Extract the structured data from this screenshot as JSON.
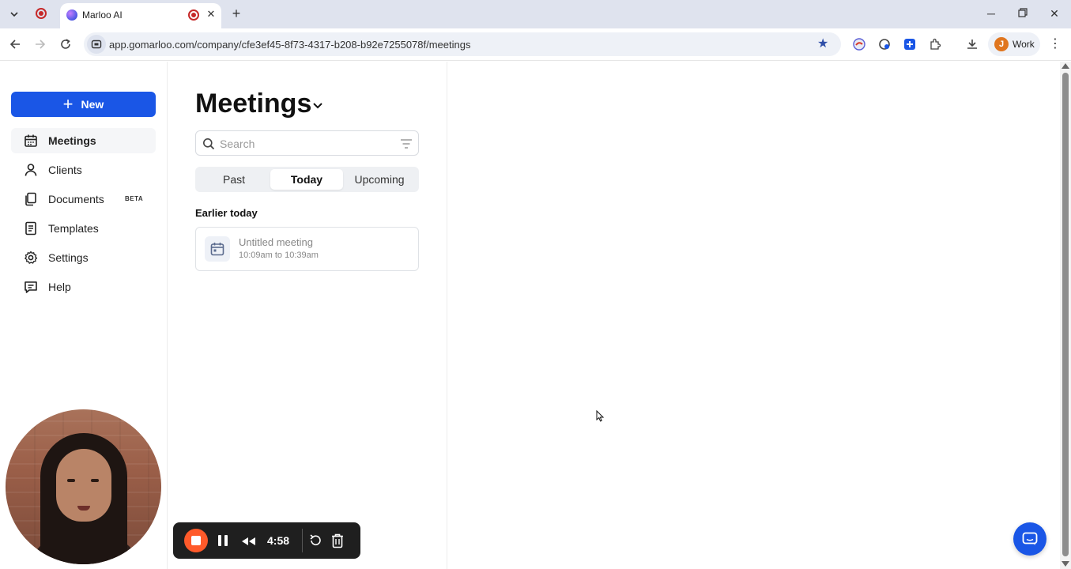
{
  "browser": {
    "tab_title": "Marloo AI",
    "url": "app.gomarloo.com/company/cfe3ef45-8f73-4317-b208-b92e7255078f/meetings",
    "profile_initial": "J",
    "profile_label": "Work",
    "accent": "#2f4fa8"
  },
  "sidebar": {
    "new_button": "New",
    "items": [
      {
        "label": "Meetings",
        "icon": "calendar-icon",
        "active": true
      },
      {
        "label": "Clients",
        "icon": "person-icon"
      },
      {
        "label": "Documents",
        "icon": "documents-icon",
        "badge": "BETA"
      },
      {
        "label": "Templates",
        "icon": "template-icon"
      },
      {
        "label": "Settings",
        "icon": "gear-icon"
      },
      {
        "label": "Help",
        "icon": "chat-bubble-icon"
      }
    ]
  },
  "main": {
    "title": "Meetings",
    "search_placeholder": "Search",
    "tabs": [
      {
        "label": "Past"
      },
      {
        "label": "Today",
        "active": true
      },
      {
        "label": "Upcoming"
      }
    ],
    "section_label": "Earlier today",
    "meetings": [
      {
        "title": "Untitled meeting",
        "time": "10:09am to 10:39am"
      }
    ]
  },
  "recorder": {
    "elapsed": "4:58"
  },
  "colors": {
    "primary": "#1a56e6",
    "record": "#ff5a2a"
  }
}
